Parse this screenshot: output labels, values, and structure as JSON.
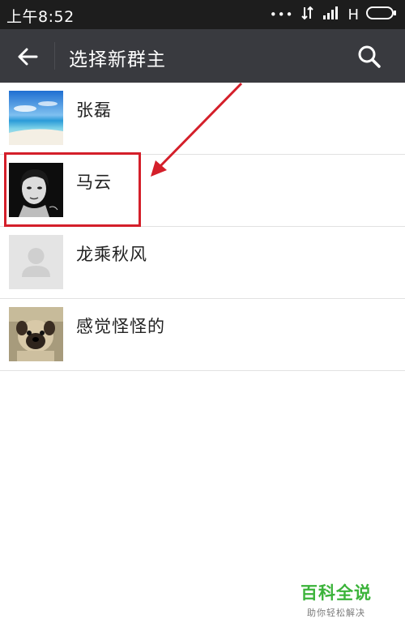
{
  "status_bar": {
    "time": "上午8:52",
    "network_label": "H",
    "icons": [
      "notification-dots-icon",
      "data-transfer-icon",
      "signal-icon",
      "battery-icon"
    ]
  },
  "header": {
    "title": "选择新群主",
    "back_icon": "back-arrow-icon",
    "search_icon": "search-icon",
    "background_color": "#393a3f"
  },
  "contacts": [
    {
      "name": "张磊",
      "avatar": "beach-photo"
    },
    {
      "name": "马云",
      "avatar": "bw-portrait-photo"
    },
    {
      "name": "龙乘秋风",
      "avatar": "default-person-icon"
    },
    {
      "name": "感觉怪怪的",
      "avatar": "pug-puppy-photo"
    }
  ],
  "annotation": {
    "highlight_color": "#d41f2a",
    "highlighted_contact": "马云"
  },
  "watermark": {
    "title": "百科全说",
    "subtitle": "助你轻松解决",
    "color": "#3bb33a"
  }
}
